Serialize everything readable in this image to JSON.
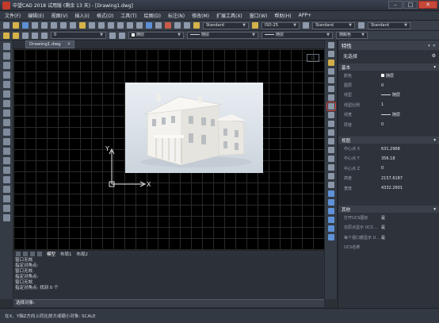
{
  "window": {
    "title": "中望CAD 2018 试用版 (剩余 13 天) - [Drawing1.dwg]",
    "controls": [
      "–",
      "□",
      "✕"
    ]
  },
  "menu": [
    "文件(F)",
    "编辑(E)",
    "视图(V)",
    "插入(I)",
    "格式(O)",
    "工具(T)",
    "绘图(D)",
    "标注(N)",
    "修改(M)",
    "扩展工具(X)",
    "窗口(W)",
    "帮助(H)",
    "APP+"
  ],
  "toolbar": {
    "text_style": "Standard",
    "dim_style": "ISO-25",
    "table_style": "Standard",
    "multileader_style": "Standard",
    "layer": "0",
    "color": "随层",
    "linetype": "随层",
    "lineweight": "随层",
    "plotstyle": "随颜色"
  },
  "drawing": {
    "tab": "Drawing1.dwg",
    "tab_close": "✕",
    "viewcube": "⬚",
    "ucs_x": "X",
    "ucs_y": "Y"
  },
  "layout_tabs": [
    "模型",
    "布局1",
    "布局2"
  ],
  "command_history": [
    "窗口无效.",
    "指定对角点:",
    "窗口无效.",
    "指定对角点:",
    "窗口无效.",
    "指定对角点: 找到 0 个"
  ],
  "command_prompt": "选择对象:",
  "status": "在X、Y轴Z方向上同比放大或缩小对象: SCALE",
  "properties": {
    "title": "特性",
    "selection": "无选择",
    "sections": {
      "basic": {
        "title": "基本",
        "rows": [
          {
            "key": "颜色",
            "value": "随层"
          },
          {
            "key": "图层",
            "value": "0"
          },
          {
            "key": "线型",
            "value": "随层"
          },
          {
            "key": "线型比例",
            "value": "1"
          },
          {
            "key": "线宽",
            "value": "随层"
          },
          {
            "key": "厚度",
            "value": "0"
          }
        ]
      },
      "view": {
        "title": "视图",
        "rows": [
          {
            "key": "中心点 X",
            "value": "631.2968"
          },
          {
            "key": "中心点 Y",
            "value": "356.18"
          },
          {
            "key": "中心点 Z",
            "value": "0"
          },
          {
            "key": "高度",
            "value": "2157.6187"
          },
          {
            "key": "宽度",
            "value": "4332.2601"
          }
        ]
      },
      "misc": {
        "title": "其他",
        "rows": [
          {
            "key": "打开UCS图标",
            "value": "是"
          },
          {
            "key": "在原点显示 UCS ...",
            "value": "是"
          },
          {
            "key": "每个视口都显示 U...",
            "value": "是"
          },
          {
            "key": "UCS名称",
            "value": ""
          }
        ]
      }
    }
  },
  "colors": {
    "accent_selected_tool": "#e0453b",
    "canvas": "#000000",
    "grid": "#2a2a2a"
  }
}
